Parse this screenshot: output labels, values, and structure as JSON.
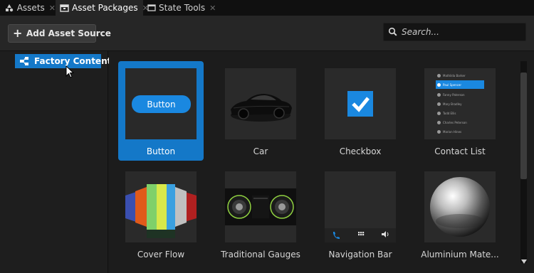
{
  "tabs": [
    {
      "label": "Assets",
      "icon": "assets-icon",
      "active": false
    },
    {
      "label": "Asset Packages",
      "icon": "package-icon",
      "active": true
    },
    {
      "label": "State Tools",
      "icon": "window-icon",
      "active": false
    }
  ],
  "toolbar": {
    "add_label": "Add Asset Source",
    "search_placeholder": "Search..."
  },
  "sidebar": {
    "items": [
      {
        "label": "Factory Content",
        "icon": "package-tree-icon",
        "selected": true
      }
    ]
  },
  "thumbnails": {
    "button_text": "Button",
    "contacts": [
      "Mathilda Barker",
      "Paul Spencer",
      "Fanny Paterson",
      "Mary Bradley",
      "Todd Ellis",
      "Charles Peterson",
      "Marion Hines"
    ],
    "contacts_sub": "Phone number"
  },
  "grid": {
    "items": [
      {
        "label": "Button",
        "selected": true
      },
      {
        "label": "Car",
        "selected": false
      },
      {
        "label": "Checkbox",
        "selected": false
      },
      {
        "label": "Contact List",
        "selected": false
      },
      {
        "label": "Cover Flow",
        "selected": false
      },
      {
        "label": "Traditional Gauges",
        "selected": false
      },
      {
        "label": "Navigation Bar",
        "selected": false
      },
      {
        "label": "Aluminium Mate...",
        "selected": false
      }
    ]
  },
  "colors": {
    "accent": "#1478c8",
    "background": "#1b1b1b",
    "panel": "#262626"
  }
}
